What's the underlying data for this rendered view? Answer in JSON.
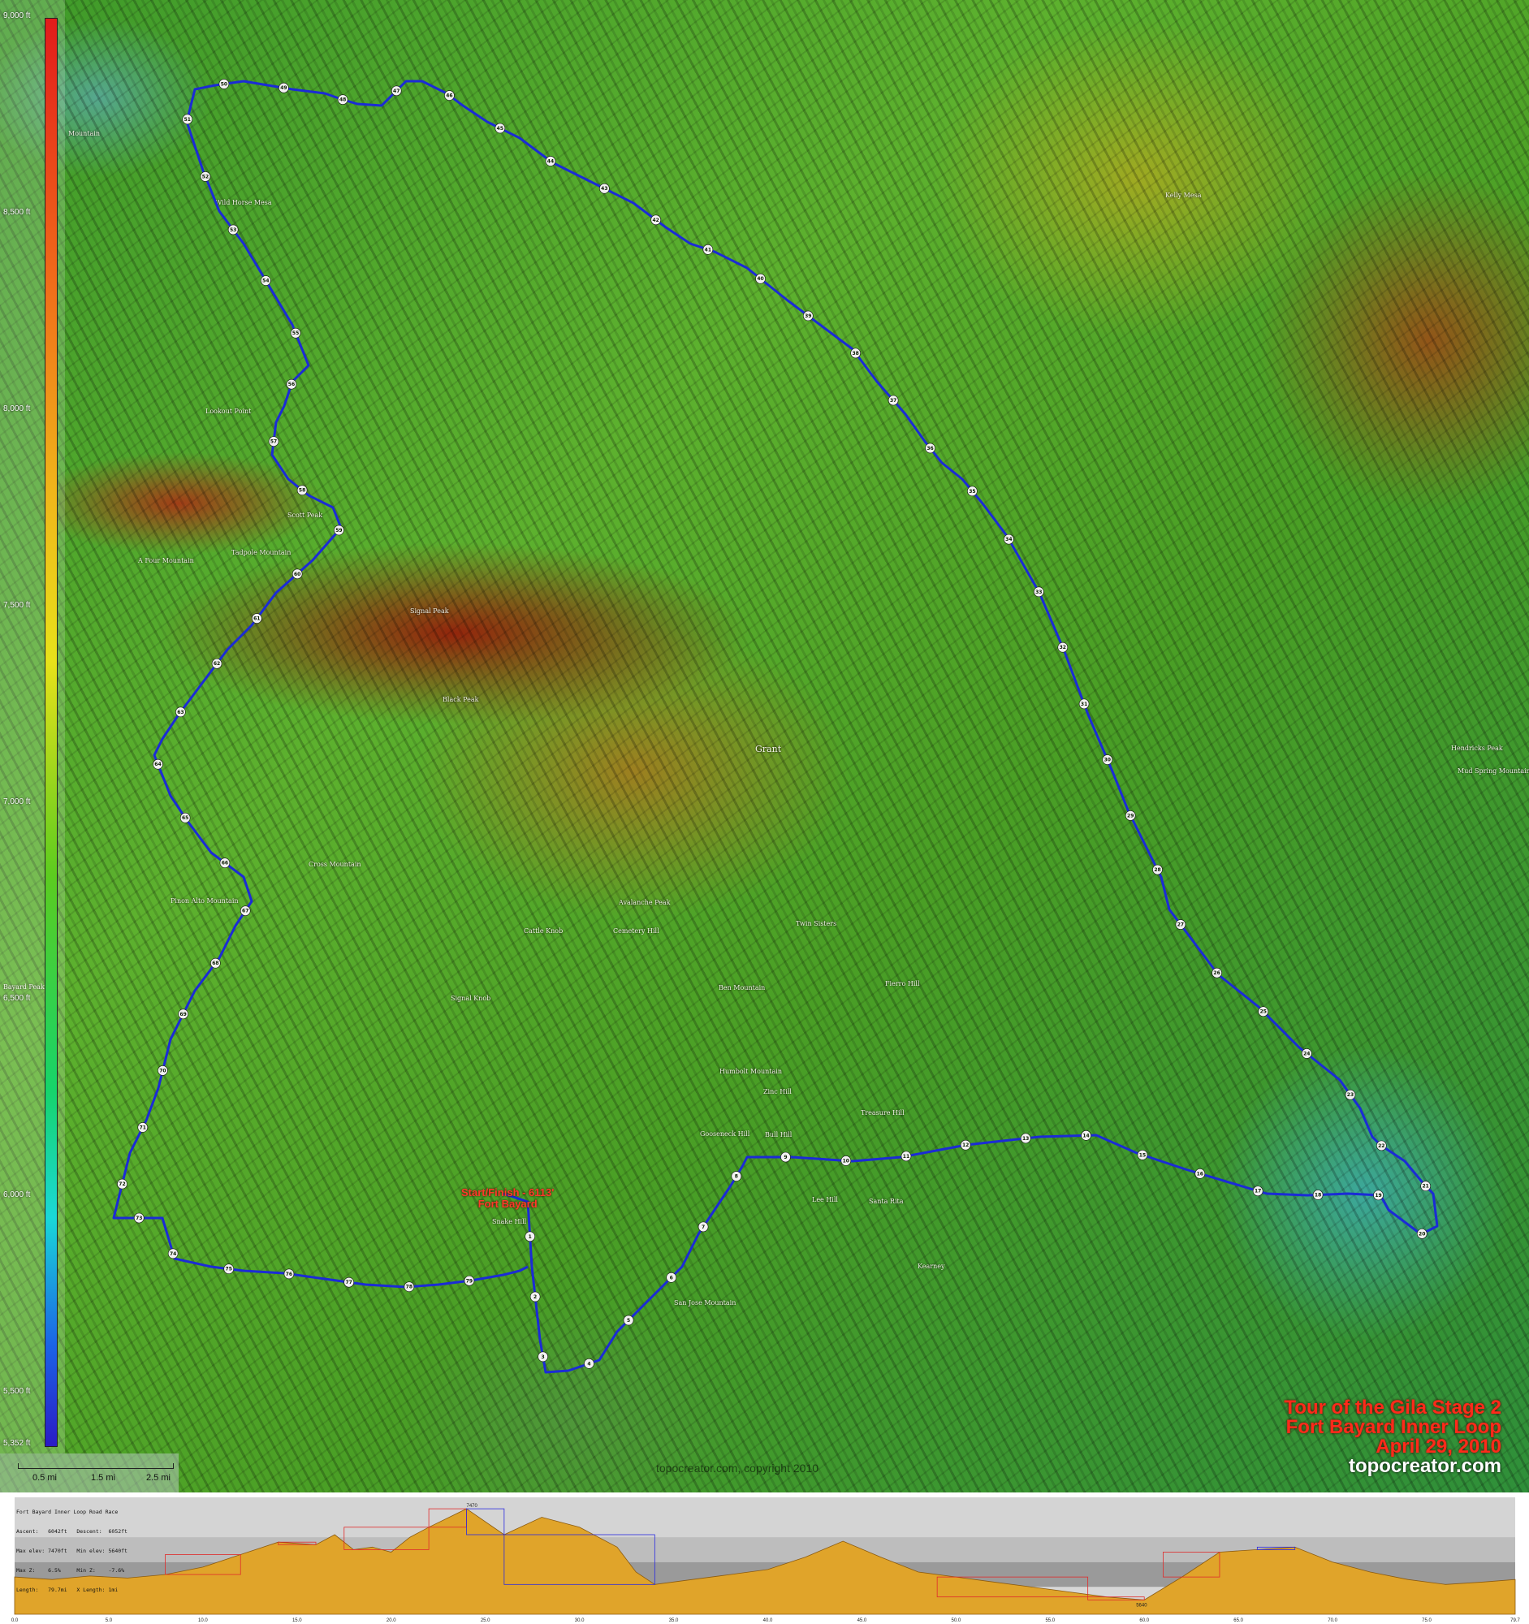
{
  "map": {
    "title_lines": [
      "Tour of the Gila Stage 2",
      "Fort Bayard Inner Loop",
      "April 29, 2010"
    ],
    "site": "topocreator.com",
    "watermark": "topocreator.com, copyright 2010",
    "start_finish": [
      "Start/Finish - 6113'",
      "Fort Bayard"
    ],
    "route_color": "#1b2bd6",
    "elevation_legend": [
      "9,000 ft",
      "8,500 ft",
      "8,000 ft",
      "7,500 ft",
      "7,000 ft",
      "6,500 ft",
      "6,000 ft",
      "5,500 ft",
      "5,352 ft"
    ],
    "scale_labels": [
      "0.5 mi",
      "1.5 mi",
      "2.5 mi"
    ],
    "places": [
      "Mountain",
      "Wild Horse Mesa",
      "Lookout Point",
      "Scott Peak",
      "A Four Mountain",
      "Tadpole Mountain",
      "Signal Peak",
      "Black Peak",
      "Grant",
      "Cross Mountain",
      "Pinon Alto Mountain",
      "Avalanche Peak",
      "Cattle Knob",
      "Cemetery Hill",
      "Signal Knob",
      "Ben Mountain",
      "Twin Sisters",
      "Humbolt Mountain",
      "Zinc Hill",
      "Gooseneck Hill",
      "Bull Hill",
      "Treasure Hill",
      "Fierro Hill",
      "Snake Hill",
      "Lee Hill",
      "Santa Rita",
      "Kearney",
      "San Jose Mountain",
      "Kelly Mesa",
      "Hendricks Peak",
      "Mud Spring Mountain",
      "Bayard Peak"
    ],
    "mile_markers": [
      "1",
      "2",
      "3",
      "4",
      "5",
      "6",
      "7",
      "8",
      "9",
      "10",
      "11",
      "12",
      "13",
      "14",
      "15",
      "16",
      "17",
      "18",
      "19",
      "20",
      "21",
      "22",
      "23",
      "24",
      "25",
      "26",
      "27",
      "28",
      "29",
      "30",
      "31",
      "32",
      "33",
      "34",
      "35",
      "36",
      "37",
      "38",
      "39",
      "40",
      "41",
      "42",
      "43",
      "44",
      "45",
      "46",
      "47",
      "48",
      "49",
      "50",
      "51",
      "52",
      "53",
      "54",
      "55",
      "56",
      "57",
      "58",
      "59",
      "60",
      "61",
      "62",
      "63",
      "64",
      "65",
      "66",
      "67",
      "68",
      "69",
      "70",
      "71",
      "72",
      "73",
      "74",
      "75",
      "76",
      "77",
      "78",
      "79"
    ]
  },
  "profile": {
    "stats": [
      "Fort Bayard Inner Loop Road Race",
      "Ascent:   6042ft   Descent:  6052ft",
      "Max elev: 7470ft   Min elev: 5640ft",
      "Max Z:    6.5%     Min Z:    -7.6%",
      "Length:   79.7mi   X Length: 1mi"
    ],
    "peak_label": "7470",
    "low_label": "5640",
    "x_ticks": [
      "0.0",
      "5.0",
      "10.0",
      "15.0",
      "20.0",
      "25.0",
      "30.0",
      "35.0",
      "40.0",
      "45.0",
      "50.0",
      "55.0",
      "60.0",
      "65.0",
      "70.0",
      "75.0",
      "79.7"
    ],
    "fill_color": "#e0a42a",
    "climb_box_color": "#e02a2a",
    "descent_box_color": "#2a2ae0"
  },
  "chart_data": {
    "type": "area",
    "title": "Fort Bayard Inner Loop Road Race",
    "xlabel": "",
    "ylabel": "",
    "x": [
      0,
      2,
      4,
      6,
      8,
      10,
      12,
      14,
      16,
      17,
      18,
      19,
      20,
      21,
      22,
      24,
      26,
      28,
      30,
      32,
      33,
      34,
      36,
      38,
      40,
      42,
      44,
      46,
      48,
      50,
      52,
      54,
      56,
      58,
      60,
      62,
      64,
      66,
      68,
      70,
      72,
      74,
      76,
      78,
      79.7
    ],
    "y": [
      6100,
      6050,
      6120,
      6080,
      6150,
      6300,
      6550,
      6800,
      6750,
      6950,
      6650,
      6700,
      6600,
      6900,
      7100,
      7470,
      6950,
      7300,
      7100,
      6700,
      6200,
      5950,
      6050,
      6150,
      6250,
      6500,
      6820,
      6500,
      6200,
      6100,
      6000,
      5900,
      5800,
      5700,
      5640,
      6100,
      6600,
      6650,
      6700,
      6400,
      6200,
      6050,
      5950,
      6000,
      6050
    ],
    "xlim": [
      0,
      79.7
    ],
    "ylim": [
      5352,
      7700
    ]
  }
}
